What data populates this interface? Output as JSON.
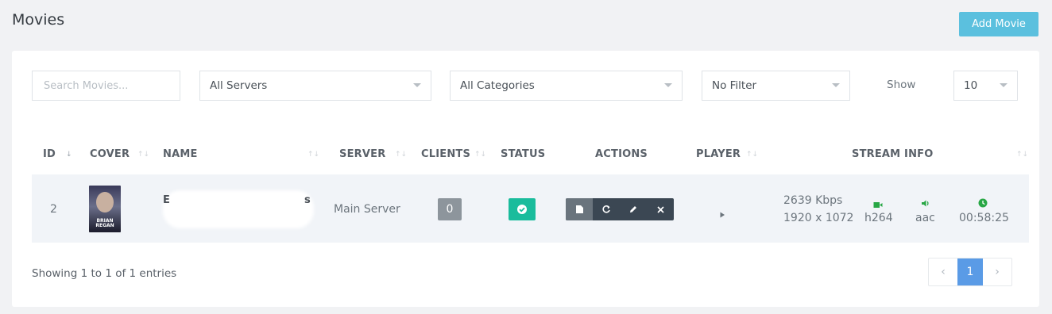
{
  "header": {
    "title": "Movies",
    "add_button": "Add Movie"
  },
  "filters": {
    "search_placeholder": "Search Movies...",
    "server": "All Servers",
    "category": "All Categories",
    "filter": "No Filter",
    "show_label": "Show",
    "show_value": "10"
  },
  "table": {
    "columns": [
      "ID",
      "COVER",
      "NAME",
      "SERVER",
      "CLIENTS",
      "STATUS",
      "ACTIONS",
      "PLAYER",
      "STREAM INFO"
    ],
    "rows": [
      {
        "id": "2",
        "cover_text": "BRIAN REGAN",
        "name_start": "E",
        "name_end": "s",
        "server": "Main Server",
        "clients": "0",
        "bitrate": "2639 Kbps",
        "resolution": "1920 x 1072",
        "video_codec": "h264",
        "audio_codec": "aac",
        "duration": "00:58:25"
      }
    ]
  },
  "footer": {
    "info": "Showing 1 to 1 of 1 entries",
    "current_page": "1"
  },
  "colors": {
    "accent": "#5bc0de",
    "status_ok": "#1abc9c",
    "pager_active": "#5a9be6",
    "stream_icon": "#28a745"
  }
}
